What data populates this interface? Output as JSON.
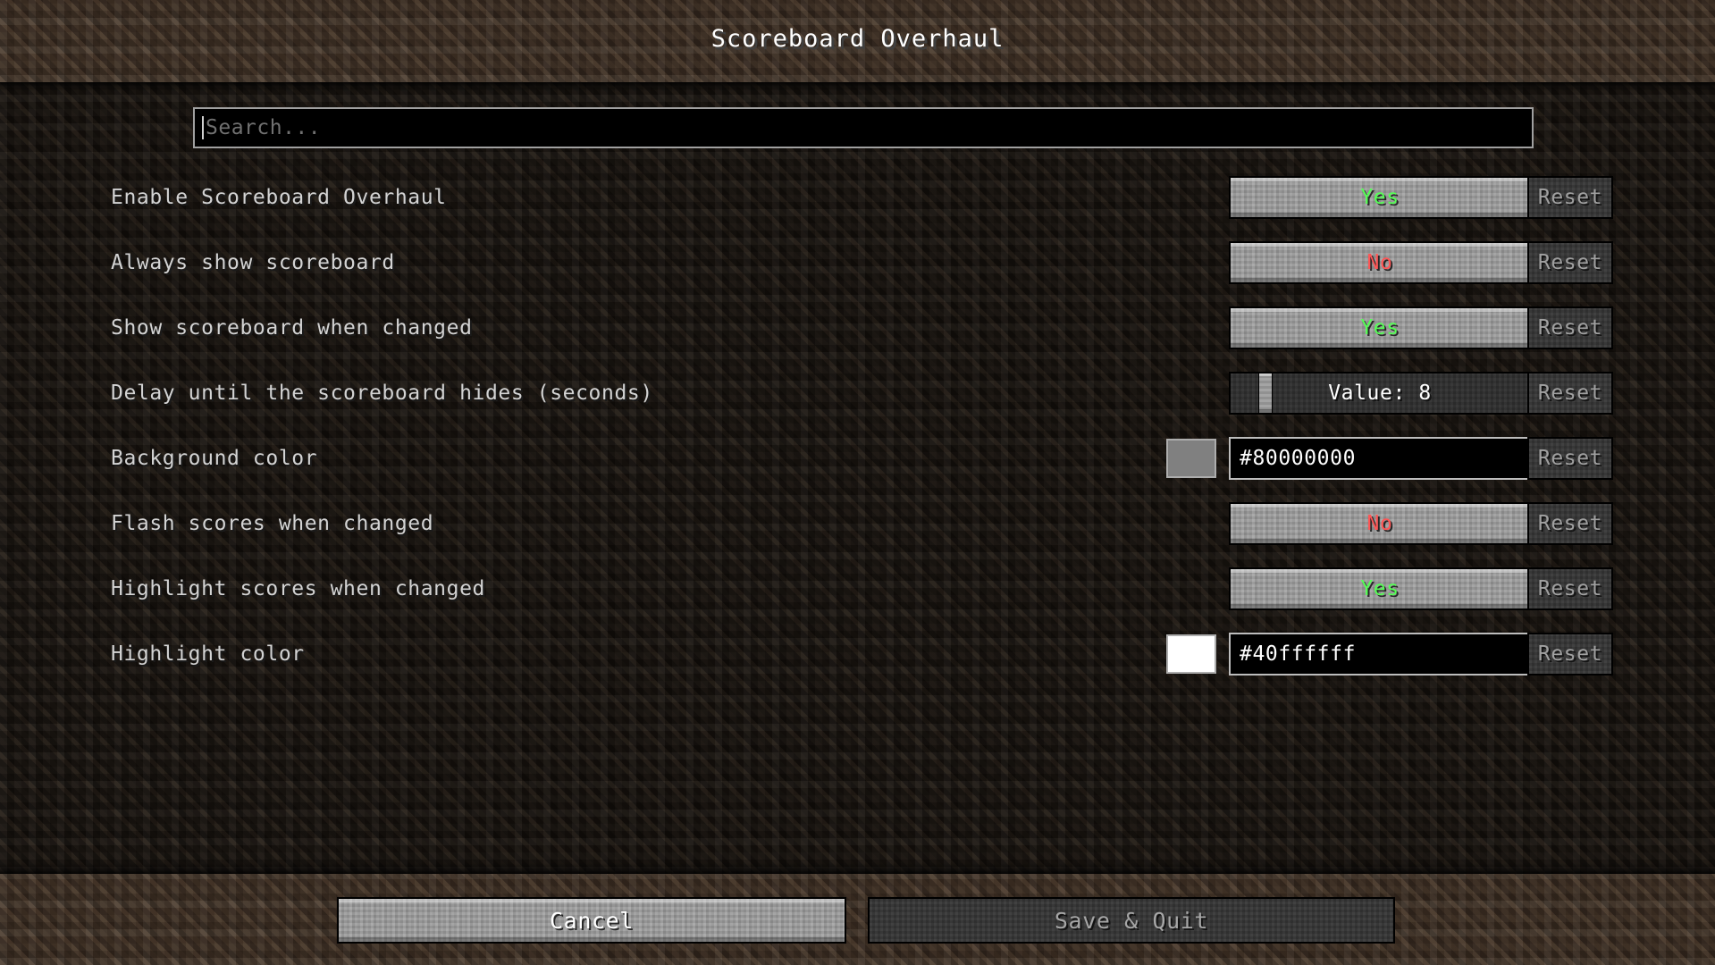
{
  "window": {
    "title": "Scoreboard Overhaul"
  },
  "search": {
    "value": "",
    "placeholder": "Search..."
  },
  "options": [
    {
      "label": "Enable Scoreboard Overhaul",
      "control": "toggle",
      "value": "Yes",
      "value_color": "#55ff55",
      "reset_label": "Reset"
    },
    {
      "label": "Always show scoreboard",
      "control": "toggle",
      "value": "No",
      "value_color": "#ff5555",
      "reset_label": "Reset"
    },
    {
      "label": "Show scoreboard when changed",
      "control": "toggle",
      "value": "Yes",
      "value_color": "#55ff55",
      "reset_label": "Reset"
    },
    {
      "label": "Delay until the scoreboard hides (seconds)",
      "control": "slider",
      "value": "Value: 8",
      "slider_number": 8,
      "slider_percent": 10,
      "reset_label": "Reset"
    },
    {
      "label": "Background color",
      "control": "color",
      "value": "#80000000",
      "swatch_color": "#808080",
      "reset_label": "Reset"
    },
    {
      "label": "Flash scores when changed",
      "control": "toggle",
      "value": "No",
      "value_color": "#ff5555",
      "reset_label": "Reset"
    },
    {
      "label": "Highlight scores when changed",
      "control": "toggle",
      "value": "Yes",
      "value_color": "#55ff55",
      "reset_label": "Reset"
    },
    {
      "label": "Highlight color",
      "control": "color",
      "value": "#40ffffff",
      "swatch_color": "#ffffff",
      "reset_label": "Reset"
    }
  ],
  "footer": {
    "cancel_label": "Cancel",
    "save_quit_label": "Save & Quit"
  },
  "colors": {
    "yes_green": "#55ff55",
    "no_red": "#ff5555",
    "label_gray": "#d3d3d3",
    "button_gray": "#9a9a9a",
    "disabled_gray": "#343434",
    "dirt_bright": "#3b2d22",
    "dirt_dim": "#16120e"
  }
}
